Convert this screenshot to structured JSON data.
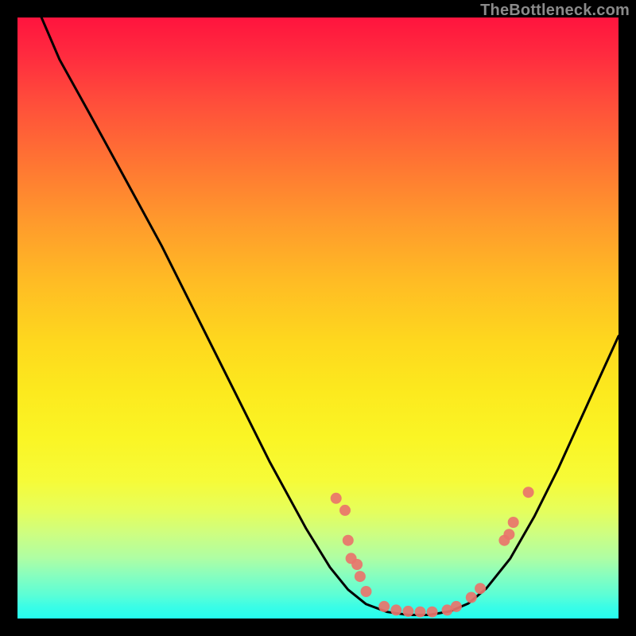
{
  "watermark": "TheBottleneck.com",
  "chart_data": {
    "type": "line",
    "title": "",
    "xlabel": "",
    "ylabel": "",
    "xlim": [
      0,
      100
    ],
    "ylim": [
      0,
      100
    ],
    "curve": {
      "name": "bottleneck-curve",
      "points": [
        {
          "x": 4.0,
          "y": 100.0
        },
        {
          "x": 7.0,
          "y": 93.0
        },
        {
          "x": 12.0,
          "y": 84.0
        },
        {
          "x": 18.0,
          "y": 73.0
        },
        {
          "x": 24.0,
          "y": 62.0
        },
        {
          "x": 30.0,
          "y": 50.0
        },
        {
          "x": 36.0,
          "y": 38.0
        },
        {
          "x": 42.0,
          "y": 26.0
        },
        {
          "x": 48.0,
          "y": 15.0
        },
        {
          "x": 52.0,
          "y": 8.5
        },
        {
          "x": 55.0,
          "y": 4.8
        },
        {
          "x": 58.0,
          "y": 2.4
        },
        {
          "x": 61.5,
          "y": 1.1
        },
        {
          "x": 65.0,
          "y": 0.6
        },
        {
          "x": 68.5,
          "y": 0.6
        },
        {
          "x": 72.0,
          "y": 1.2
        },
        {
          "x": 75.0,
          "y": 2.5
        },
        {
          "x": 78.0,
          "y": 5.0
        },
        {
          "x": 82.0,
          "y": 10.0
        },
        {
          "x": 86.0,
          "y": 17.0
        },
        {
          "x": 90.0,
          "y": 25.0
        },
        {
          "x": 95.0,
          "y": 36.0
        },
        {
          "x": 100.0,
          "y": 47.0
        }
      ]
    },
    "markers": {
      "name": "curve-markers",
      "points": [
        {
          "x": 53.0,
          "y": 20.0
        },
        {
          "x": 54.5,
          "y": 18.0
        },
        {
          "x": 55.0,
          "y": 13.0
        },
        {
          "x": 55.5,
          "y": 10.0
        },
        {
          "x": 56.5,
          "y": 9.0
        },
        {
          "x": 57.0,
          "y": 7.0
        },
        {
          "x": 58.0,
          "y": 4.5
        },
        {
          "x": 61.0,
          "y": 2.0
        },
        {
          "x": 63.0,
          "y": 1.4
        },
        {
          "x": 65.0,
          "y": 1.2
        },
        {
          "x": 67.0,
          "y": 1.1
        },
        {
          "x": 69.0,
          "y": 1.1
        },
        {
          "x": 71.5,
          "y": 1.4
        },
        {
          "x": 73.0,
          "y": 2.0
        },
        {
          "x": 75.5,
          "y": 3.5
        },
        {
          "x": 77.0,
          "y": 5.0
        },
        {
          "x": 81.0,
          "y": 13.0
        },
        {
          "x": 81.8,
          "y": 14.0
        },
        {
          "x": 82.5,
          "y": 16.0
        },
        {
          "x": 85.0,
          "y": 21.0
        }
      ]
    },
    "color_scale_note": "vertical gradient red→yellow→green→cyan encodes bottleneck severity"
  }
}
